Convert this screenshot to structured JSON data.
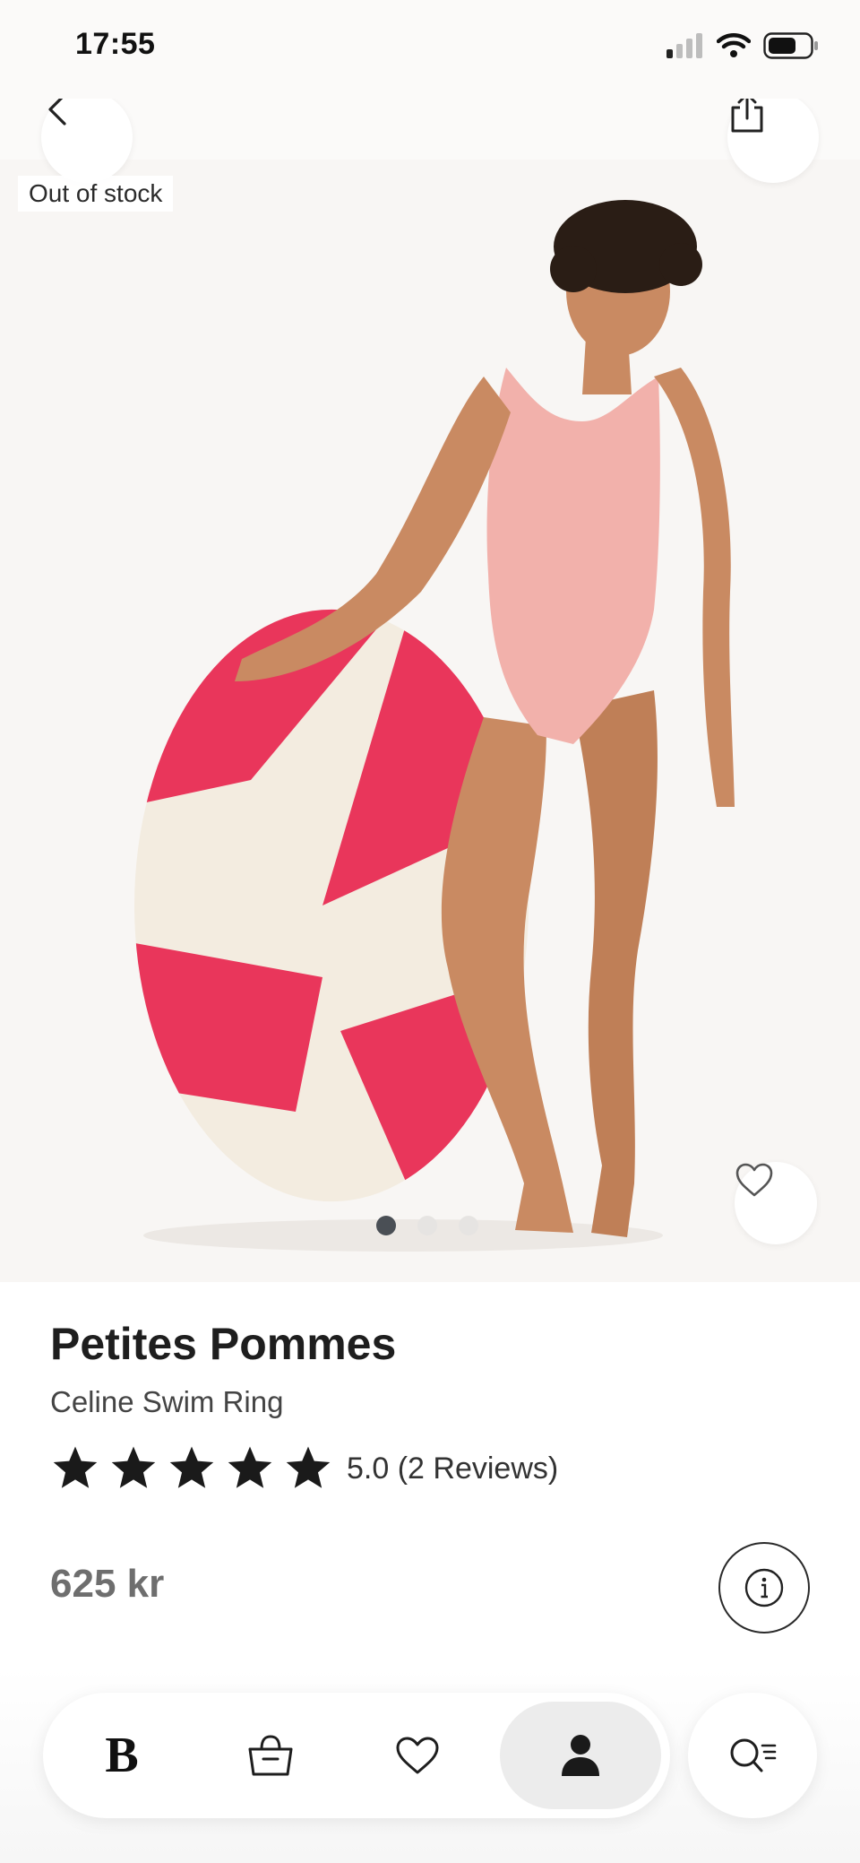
{
  "status_bar": {
    "time": "17:55"
  },
  "product_image": {
    "stock_badge": "Out of stock",
    "carousel": {
      "count": 3,
      "active_index": 0
    }
  },
  "product": {
    "brand": "Petites Pommes",
    "name": "Celine Swim Ring",
    "rating_value": 5,
    "rating_text": "5.0 (2 Reviews)",
    "price": "625 kr"
  },
  "bottom_nav": {
    "logo": "B",
    "items": [
      "home",
      "bag",
      "favorites",
      "profile"
    ],
    "active": "profile"
  },
  "colors": {
    "ring_red": "#e9365b",
    "ring_cream": "#f3ece0",
    "swimsuit": "#f2b1ab",
    "text_dark": "#1e1e1e",
    "price_gray": "#6e6e6e"
  },
  "icons": [
    "chevron-left-icon",
    "share-icon",
    "heart-icon",
    "star-icon",
    "info-icon",
    "bag-icon",
    "profile-icon",
    "search-filter-icon",
    "wifi-icon",
    "battery-icon",
    "signal-icon"
  ]
}
